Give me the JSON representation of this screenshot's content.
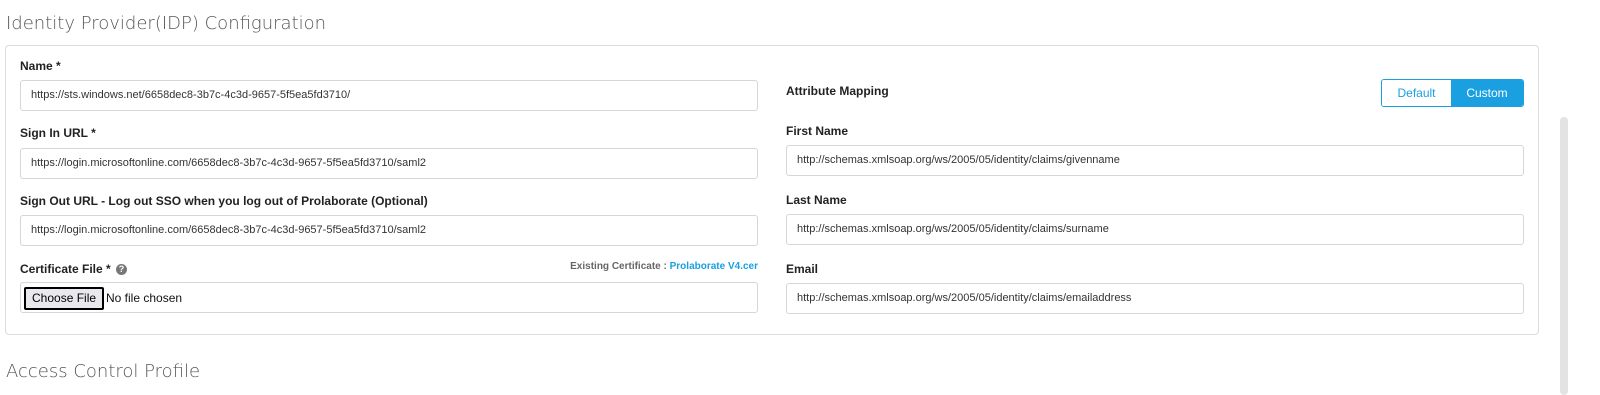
{
  "sections": {
    "idp_title": "Identity Provider(IDP) Configuration",
    "acp_title": "Access Control Profile"
  },
  "idp": {
    "name_label": "Name *",
    "name_value": "https://sts.windows.net/6658dec8-3b7c-4c3d-9657-5f5ea5fd3710/",
    "signin_label": "Sign In URL *",
    "signin_value": "https://login.microsoftonline.com/6658dec8-3b7c-4c3d-9657-5f5ea5fd3710/saml2",
    "signout_label": "Sign Out URL - Log out SSO when you log out of Prolaborate (Optional)",
    "signout_value": "https://login.microsoftonline.com/6658dec8-3b7c-4c3d-9657-5f5ea5fd3710/saml2",
    "cert_label": "Certificate File *",
    "help_icon": "?",
    "existing_cert_label": "Existing Certificate :",
    "existing_cert_link": "Prolaborate V4.cer",
    "choose_file_button": "Choose File",
    "no_file_text": "No file chosen"
  },
  "attribute_mapping": {
    "label": "Attribute Mapping",
    "toggle": {
      "default_label": "Default",
      "custom_label": "Custom",
      "selected": "Custom"
    },
    "first_name_label": "First Name",
    "first_name_value": "http://schemas.xmlsoap.org/ws/2005/05/identity/claims/givenname",
    "last_name_label": "Last Name",
    "last_name_value": "http://schemas.xmlsoap.org/ws/2005/05/identity/claims/surname",
    "email_label": "Email",
    "email_value": "http://schemas.xmlsoap.org/ws/2005/05/identity/claims/emailaddress"
  },
  "colors": {
    "accent": "#1aa0e0",
    "border": "#dcdcdc"
  }
}
